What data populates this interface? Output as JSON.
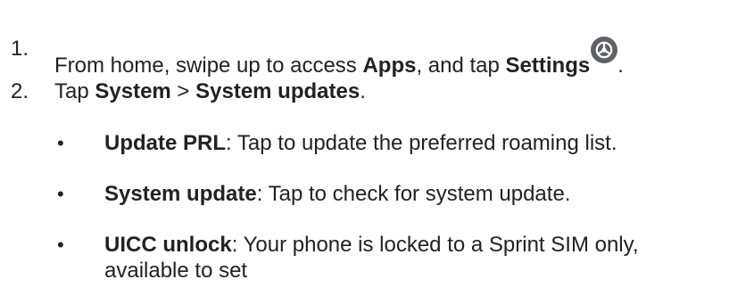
{
  "steps": [
    {
      "number": "1.",
      "text_a": "From home, swipe up to access ",
      "bold_a": "Apps",
      "text_b": ", and tap ",
      "bold_b": "Settings",
      "icon": "settings-gear-icon",
      "text_c": "."
    },
    {
      "number": "2.",
      "text_a": "Tap ",
      "bold_a": "System",
      "text_b": " > ",
      "bold_b": "System updates",
      "text_c": "."
    }
  ],
  "bullet_glyph": "•",
  "options": [
    {
      "label": "Update PRL",
      "description": ": Tap to update the preferred roaming list."
    },
    {
      "label": "System update",
      "description": ": Tap to check for system update."
    },
    {
      "label": "UICC unlock",
      "description": ": Your phone is locked to a Sprint SIM only,",
      "description_cont": "available to set"
    }
  ],
  "colors": {
    "text": "#222222",
    "icon_fill": "#5f6368"
  }
}
